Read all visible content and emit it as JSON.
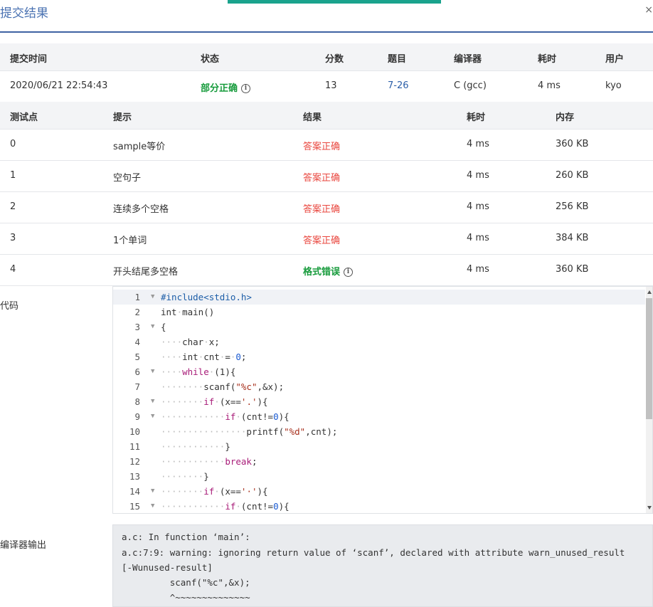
{
  "header": {
    "title": "提交结果",
    "close": "×"
  },
  "submission": {
    "columns": [
      "提交时间",
      "状态",
      "分数",
      "题目",
      "编译器",
      "耗时",
      "用户"
    ],
    "row": {
      "time": "2020/06/21 22:54:43",
      "status": "部分正确",
      "score": "13",
      "problem": "7-26",
      "compiler": "C (gcc)",
      "elapsed": "4 ms",
      "user": "kyo"
    }
  },
  "tests": {
    "columns": [
      "测试点",
      "提示",
      "结果",
      "耗时",
      "内存"
    ],
    "rows": [
      {
        "id": "0",
        "hint": "sample等价",
        "result": "答案正确",
        "time": "4 ms",
        "mem": "360 KB"
      },
      {
        "id": "1",
        "hint": "空句子",
        "result": "答案正确",
        "time": "4 ms",
        "mem": "260 KB"
      },
      {
        "id": "2",
        "hint": "连续多个空格",
        "result": "答案正确",
        "time": "4 ms",
        "mem": "256 KB"
      },
      {
        "id": "3",
        "hint": "1个单词",
        "result": "答案正确",
        "time": "4 ms",
        "mem": "384 KB"
      },
      {
        "id": "4",
        "hint": "开头结尾多空格",
        "result": "格式错误",
        "time": "4 ms",
        "mem": "360 KB"
      }
    ]
  },
  "code_section": {
    "label": "代码",
    "lines": [
      "#include<stdio.h>",
      "int main()",
      "{",
      "    char x;",
      "    int cnt = 0;",
      "    while (1){",
      "        scanf(\"%c\",&x);",
      "        if (x=='.'){",
      "            if (cnt!=0){",
      "                printf(\"%d\",cnt);",
      "            }",
      "            break;",
      "        }",
      "        if (x==' '){",
      "            if (cnt!=0){"
    ]
  },
  "compiler_output": {
    "label": "编译器输出",
    "lines": [
      "a.c: In function ‘main’:",
      "a.c:7:9: warning: ignoring return value of ‘scanf’, declared with attribute warn_unused_result",
      "[-Wunused-result]",
      "         scanf(\"%c\",&x);",
      "         ^~~~~~~~~~~~~~~"
    ]
  },
  "colors": {
    "accent": "#1aa38d",
    "header_line": "#3f63a3",
    "correct": "#e9473f",
    "partial": "#179b3c",
    "link": "#2c5fa8"
  }
}
